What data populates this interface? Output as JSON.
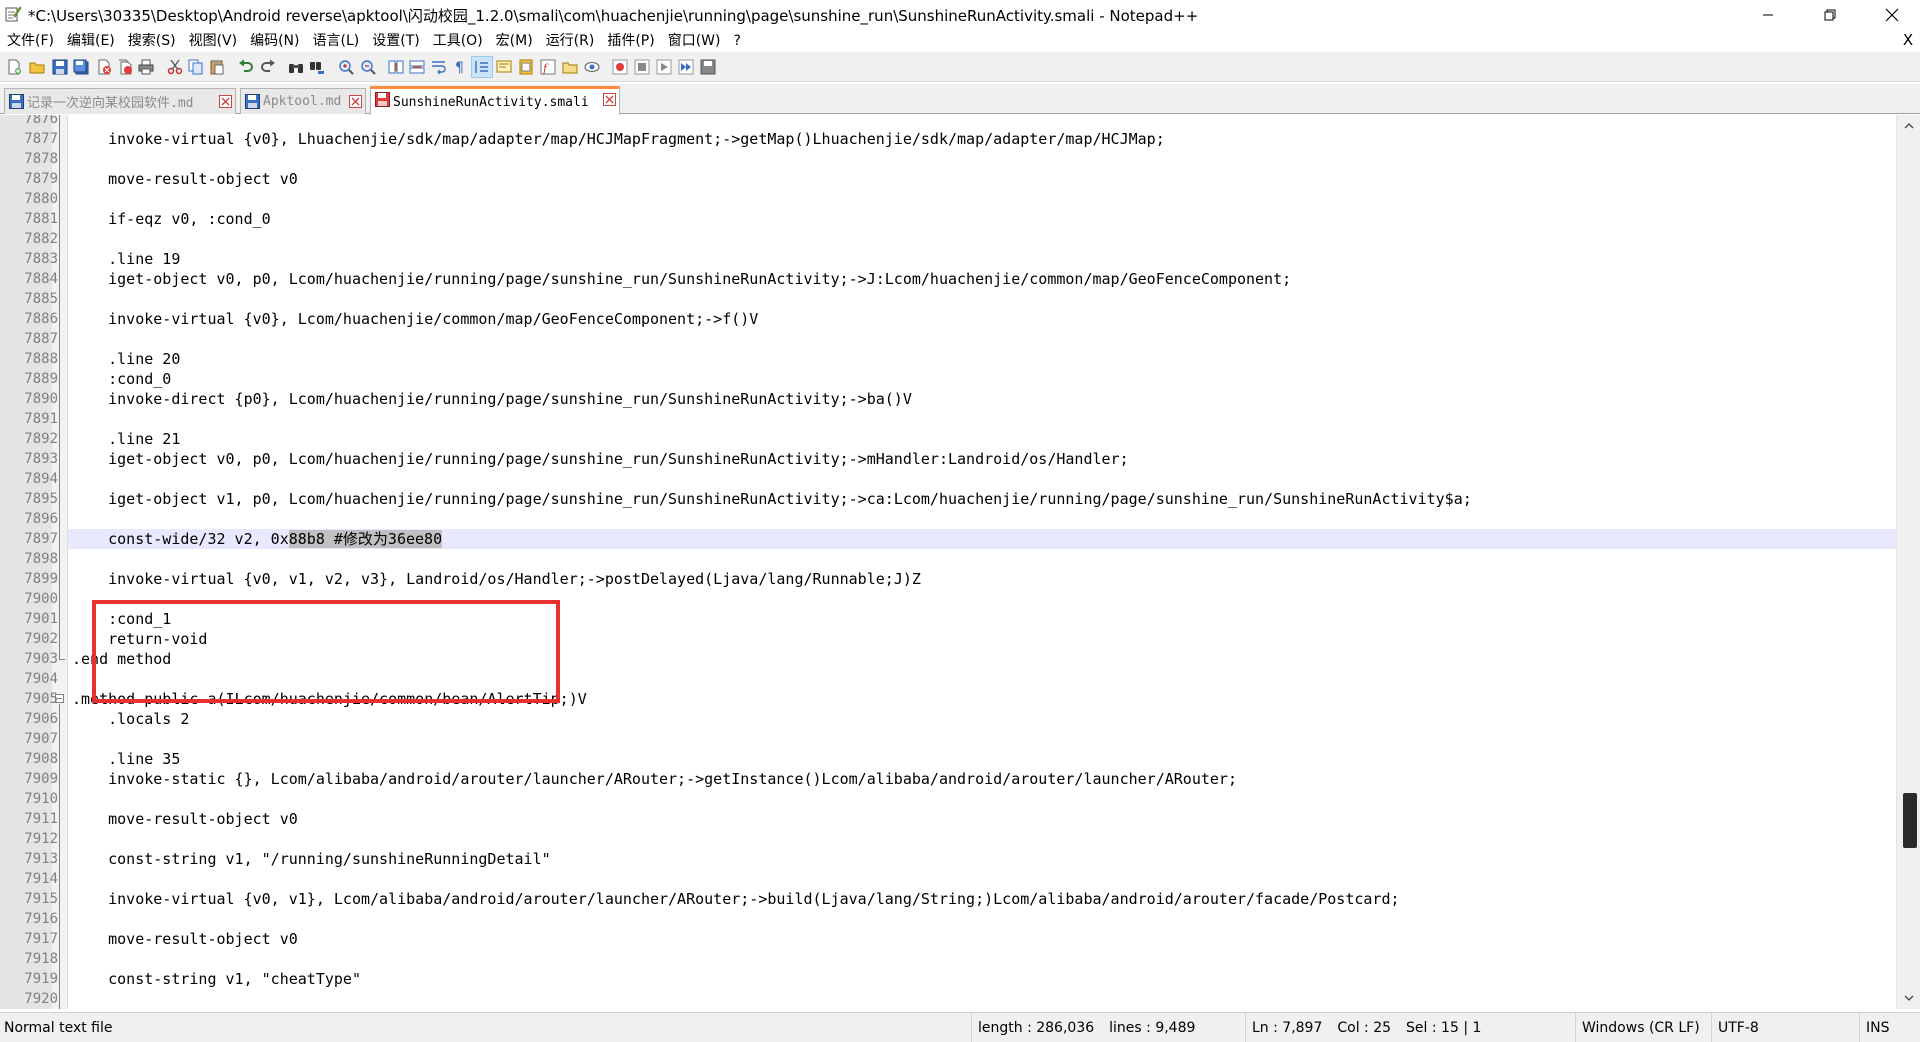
{
  "window": {
    "title": "*C:\\Users\\30335\\Desktop\\Android reverse\\apktool\\闪动校园_1.2.0\\smali\\com\\huachenjie\\running\\page\\sunshine_run\\SunshineRunActivity.smali - Notepad++"
  },
  "menu": [
    "文件(F)",
    "编辑(E)",
    "搜索(S)",
    "视图(V)",
    "编码(N)",
    "语言(L)",
    "设置(T)",
    "工具(O)",
    "宏(M)",
    "运行(R)",
    "插件(P)",
    "窗口(W)",
    "?"
  ],
  "menu_close_glyph": "X",
  "tabs": [
    {
      "label": "记录一次逆向某校园软件.md",
      "active": false
    },
    {
      "label": "Apktool.md",
      "active": false
    },
    {
      "label": "SunshineRunActivity.smali",
      "active": true
    }
  ],
  "editor": {
    "current_line": 7897,
    "lines": [
      {
        "n": "7876",
        "t": ""
      },
      {
        "n": "7877",
        "t": "    invoke-virtual {v0}, Lhuachenjie/sdk/map/adapter/map/HCJMapFragment;->getMap()Lhuachenjie/sdk/map/adapter/map/HCJMap;"
      },
      {
        "n": "7878",
        "t": ""
      },
      {
        "n": "7879",
        "t": "    move-result-object v0"
      },
      {
        "n": "7880",
        "t": ""
      },
      {
        "n": "7881",
        "t": "    if-eqz v0, :cond_0"
      },
      {
        "n": "7882",
        "t": ""
      },
      {
        "n": "7883",
        "t": "    .line 19"
      },
      {
        "n": "7884",
        "t": "    iget-object v0, p0, Lcom/huachenjie/running/page/sunshine_run/SunshineRunActivity;->J:Lcom/huachenjie/common/map/GeoFenceComponent;"
      },
      {
        "n": "7885",
        "t": ""
      },
      {
        "n": "7886",
        "t": "    invoke-virtual {v0}, Lcom/huachenjie/common/map/GeoFenceComponent;->f()V"
      },
      {
        "n": "7887",
        "t": ""
      },
      {
        "n": "7888",
        "t": "    .line 20"
      },
      {
        "n": "7889",
        "t": "    :cond_0"
      },
      {
        "n": "7890",
        "t": "    invoke-direct {p0}, Lcom/huachenjie/running/page/sunshine_run/SunshineRunActivity;->ba()V"
      },
      {
        "n": "7891",
        "t": ""
      },
      {
        "n": "7892",
        "t": "    .line 21"
      },
      {
        "n": "7893",
        "t": "    iget-object v0, p0, Lcom/huachenjie/running/page/sunshine_run/SunshineRunActivity;->mHandler:Landroid/os/Handler;"
      },
      {
        "n": "7894",
        "t": ""
      },
      {
        "n": "7895",
        "t": "    iget-object v1, p0, Lcom/huachenjie/running/page/sunshine_run/SunshineRunActivity;->ca:Lcom/huachenjie/running/page/sunshine_run/SunshineRunActivity$a;"
      },
      {
        "n": "7896",
        "t": ""
      },
      {
        "n": "7897",
        "t": "    const-wide/32 v2, 0x",
        "sel": "88b8 #修改为36ee80"
      },
      {
        "n": "7898",
        "t": ""
      },
      {
        "n": "7899",
        "t": "    invoke-virtual {v0, v1, v2, v3}, Landroid/os/Handler;->postDelayed(Ljava/lang/Runnable;J)Z"
      },
      {
        "n": "7900",
        "t": ""
      },
      {
        "n": "7901",
        "t": "    :cond_1"
      },
      {
        "n": "7902",
        "t": "    return-void"
      },
      {
        "n": "7903",
        "t": ".end method"
      },
      {
        "n": "7904",
        "t": ""
      },
      {
        "n": "7905",
        "t": ".method public a(ILcom/huachenjie/common/bean/AlertTip;)V"
      },
      {
        "n": "7906",
        "t": "    .locals 2"
      },
      {
        "n": "7907",
        "t": ""
      },
      {
        "n": "7908",
        "t": "    .line 35"
      },
      {
        "n": "7909",
        "t": "    invoke-static {}, Lcom/alibaba/android/arouter/launcher/ARouter;->getInstance()Lcom/alibaba/android/arouter/launcher/ARouter;"
      },
      {
        "n": "7910",
        "t": ""
      },
      {
        "n": "7911",
        "t": "    move-result-object v0"
      },
      {
        "n": "7912",
        "t": ""
      },
      {
        "n": "7913",
        "t": "    const-string v1, \"/running/sunshineRunningDetail\""
      },
      {
        "n": "7914",
        "t": ""
      },
      {
        "n": "7915",
        "t": "    invoke-virtual {v0, v1}, Lcom/alibaba/android/arouter/launcher/ARouter;->build(Ljava/lang/String;)Lcom/alibaba/android/arouter/facade/Postcard;"
      },
      {
        "n": "7916",
        "t": ""
      },
      {
        "n": "7917",
        "t": "    move-result-object v0"
      },
      {
        "n": "7918",
        "t": ""
      },
      {
        "n": "7919",
        "t": "    const-string v1, \"cheatType\""
      },
      {
        "n": "7920",
        "t": ""
      }
    ]
  },
  "status": {
    "file_type": "Normal text file",
    "length": "length : 286,036",
    "lines": "lines : 9,489",
    "ln": "Ln : 7,897",
    "col": "Col : 25",
    "sel": "Sel : 15 | 1",
    "eol": "Windows (CR LF)",
    "encoding": "UTF-8",
    "mode": "INS"
  },
  "colors": {
    "annotation": "#e8302f",
    "active_tab_accent": "#fa8c3c",
    "current_line": "#e8e8ff",
    "selection": "#c0c0c0"
  }
}
